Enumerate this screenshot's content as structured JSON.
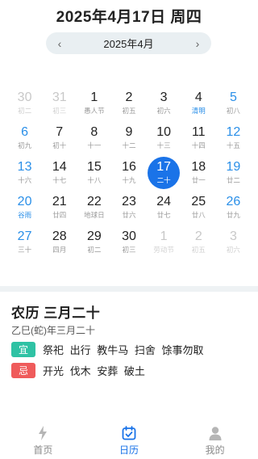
{
  "header": {
    "date_title": "2025年4月17日  周四"
  },
  "month_nav": {
    "label": "2025年4月",
    "prev_icon": "chevron-left-icon",
    "next_icon": "chevron-right-icon"
  },
  "calendar": {
    "days": [
      {
        "d": "30",
        "l": "初二",
        "outside": true,
        "weekend": false
      },
      {
        "d": "31",
        "l": "初三",
        "outside": true,
        "weekend": false
      },
      {
        "d": "1",
        "l": "愚人节",
        "weekend": false
      },
      {
        "d": "2",
        "l": "初五",
        "weekend": false
      },
      {
        "d": "3",
        "l": "初六",
        "weekend": false
      },
      {
        "d": "4",
        "l": "清明",
        "weekend": false,
        "term": true
      },
      {
        "d": "5",
        "l": "初八",
        "weekend": true
      },
      {
        "d": "6",
        "l": "初九",
        "weekend": true
      },
      {
        "d": "7",
        "l": "初十",
        "weekend": false
      },
      {
        "d": "8",
        "l": "十一",
        "weekend": false
      },
      {
        "d": "9",
        "l": "十二",
        "weekend": false
      },
      {
        "d": "10",
        "l": "十三",
        "weekend": false
      },
      {
        "d": "11",
        "l": "十四",
        "weekend": false
      },
      {
        "d": "12",
        "l": "十五",
        "weekend": true
      },
      {
        "d": "13",
        "l": "十六",
        "weekend": true
      },
      {
        "d": "14",
        "l": "十七",
        "weekend": false
      },
      {
        "d": "15",
        "l": "十八",
        "weekend": false
      },
      {
        "d": "16",
        "l": "十九",
        "weekend": false
      },
      {
        "d": "17",
        "l": "二十",
        "weekend": false,
        "selected": true
      },
      {
        "d": "18",
        "l": "廿一",
        "weekend": false
      },
      {
        "d": "19",
        "l": "廿二",
        "weekend": true
      },
      {
        "d": "20",
        "l": "谷雨",
        "weekend": true,
        "term": true
      },
      {
        "d": "21",
        "l": "廿四",
        "weekend": false
      },
      {
        "d": "22",
        "l": "地球日",
        "weekend": false
      },
      {
        "d": "23",
        "l": "廿六",
        "weekend": false
      },
      {
        "d": "24",
        "l": "廿七",
        "weekend": false
      },
      {
        "d": "25",
        "l": "廿八",
        "weekend": false
      },
      {
        "d": "26",
        "l": "廿九",
        "weekend": true
      },
      {
        "d": "27",
        "l": "三十",
        "weekend": true
      },
      {
        "d": "28",
        "l": "四月",
        "weekend": false
      },
      {
        "d": "29",
        "l": "初二",
        "weekend": false
      },
      {
        "d": "30",
        "l": "初三",
        "weekend": false
      },
      {
        "d": "1",
        "l": "劳动节",
        "outside": true,
        "weekend": false
      },
      {
        "d": "2",
        "l": "初五",
        "outside": true,
        "weekend": false
      },
      {
        "d": "3",
        "l": "初六",
        "outside": true,
        "weekend": false
      }
    ]
  },
  "detail": {
    "lunar_title": "农历  三月二十",
    "ganzhi": "乙巳(蛇)年三月二十",
    "yi_label": "宜",
    "yi_text": "祭祀 出行 教牛马 扫舍 馀事勿取",
    "ji_label": "忌",
    "ji_text": "开光 伐木 安葬 破土"
  },
  "colors": {
    "accent": "#1a73e8",
    "weekend": "#2a8fe8",
    "yi": "#2fc2a4",
    "ji": "#ef5b5b"
  },
  "tabbar": {
    "items": [
      {
        "label": "首页",
        "icon": "lightning-icon",
        "active": false
      },
      {
        "label": "日历",
        "icon": "calendar-icon",
        "active": true
      },
      {
        "label": "我的",
        "icon": "person-icon",
        "active": false
      }
    ]
  }
}
